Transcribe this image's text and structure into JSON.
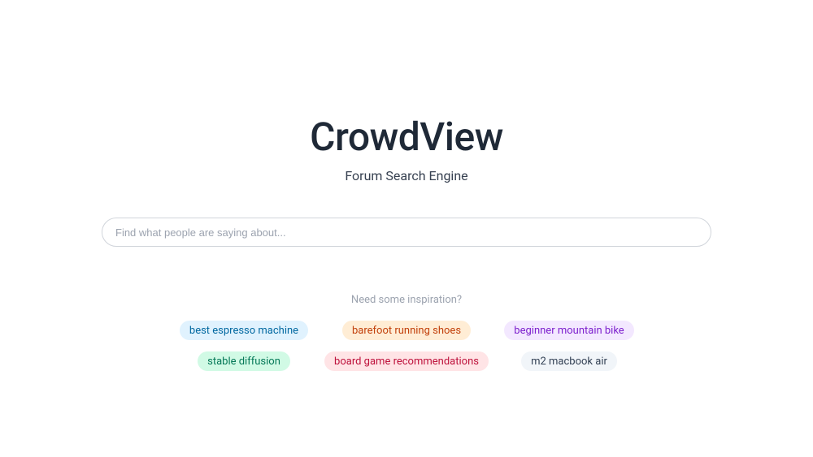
{
  "header": {
    "title": "CrowdView",
    "subtitle": "Forum Search Engine"
  },
  "search": {
    "placeholder": "Find what people are saying about...",
    "value": ""
  },
  "inspiration": {
    "label": "Need some inspiration?",
    "pills": [
      {
        "label": "best espresso machine",
        "colorClass": "pill-sky"
      },
      {
        "label": "barefoot running shoes",
        "colorClass": "pill-orange"
      },
      {
        "label": "beginner mountain bike",
        "colorClass": "pill-purple"
      },
      {
        "label": "stable diffusion",
        "colorClass": "pill-emerald"
      },
      {
        "label": "board game recommendations",
        "colorClass": "pill-rose"
      },
      {
        "label": "m2 macbook air",
        "colorClass": "pill-slate"
      }
    ]
  }
}
